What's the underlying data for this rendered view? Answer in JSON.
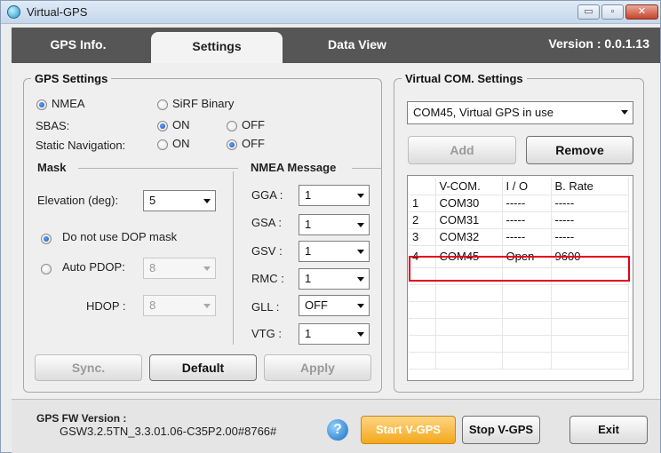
{
  "window": {
    "title": "Virtual-GPS",
    "controls": {
      "minimize": "▭",
      "maximize": "▫",
      "close": "✕"
    }
  },
  "tabs": [
    {
      "label": "GPS Info."
    },
    {
      "label": "Settings"
    },
    {
      "label": "Data View"
    }
  ],
  "version": "Version : 0.0.1.13",
  "gps_settings": {
    "legend": "GPS Settings",
    "protocol": {
      "nmea": "NMEA",
      "sirf": "SiRF Binary",
      "selected": "NMEA"
    },
    "sbas": {
      "label": "SBAS:",
      "on": "ON",
      "off": "OFF",
      "selected": "ON"
    },
    "static_nav": {
      "label": "Static Navigation:",
      "on": "ON",
      "off": "OFF",
      "selected": "OFF"
    }
  },
  "mask": {
    "legend": "Mask",
    "elevation_label": "Elevation (deg):",
    "elevation_value": "5",
    "no_dop_label": "Do not use DOP mask",
    "auto_pdop_label": "Auto PDOP:",
    "auto_pdop_value": "8",
    "hdop_label": "HDOP :",
    "hdop_value": "8"
  },
  "nmea": {
    "legend": "NMEA Message",
    "messages": [
      {
        "label": "GGA :",
        "value": "1"
      },
      {
        "label": "GSA :",
        "value": "1"
      },
      {
        "label": "GSV :",
        "value": "1"
      },
      {
        "label": "RMC :",
        "value": "1"
      },
      {
        "label": "GLL :",
        "value": "OFF"
      },
      {
        "label": "VTG :",
        "value": "1"
      }
    ]
  },
  "buttons": {
    "sync": "Sync.",
    "default": "Default",
    "apply": "Apply"
  },
  "vcom": {
    "legend": "Virtual COM. Settings",
    "selected_port": "COM45, Virtual GPS in use",
    "add": "Add",
    "remove": "Remove",
    "headers": [
      "",
      "V-COM.",
      "I / O",
      "B. Rate"
    ],
    "rows": [
      [
        "1",
        "COM30",
        "-----",
        "-----"
      ],
      [
        "2",
        "COM31",
        "-----",
        "-----"
      ],
      [
        "3",
        "COM32",
        "-----",
        "-----"
      ],
      [
        "4",
        "COM45",
        "Open",
        "9600"
      ]
    ]
  },
  "footer": {
    "fw_label": "GPS FW Version :",
    "fw_value": "GSW3.2.5TN_3.3.01.06-C35P2.00#8766#",
    "help": "?",
    "start": "Start V-GPS",
    "stop": "Stop V-GPS",
    "exit": "Exit"
  }
}
